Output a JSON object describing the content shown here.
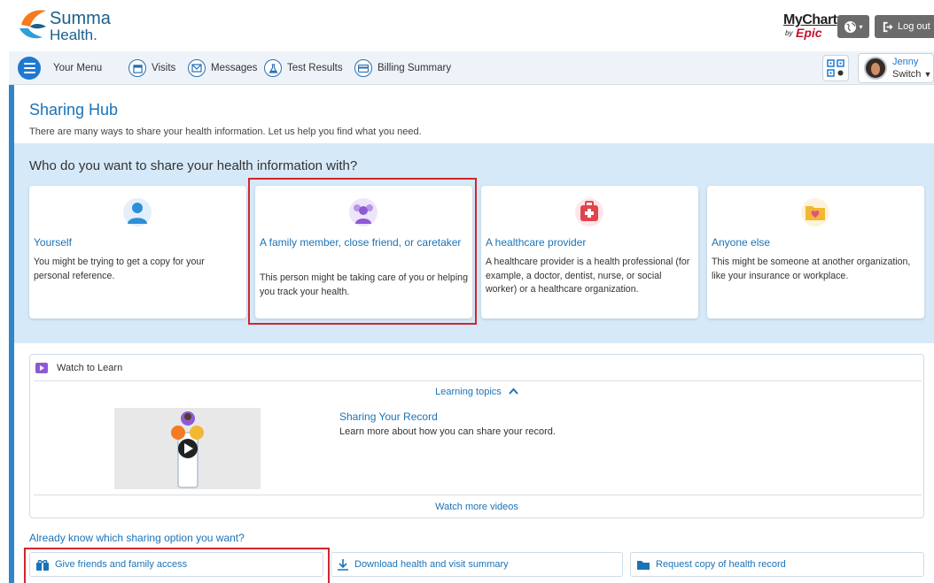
{
  "brand": {
    "name_line1": "Summa",
    "name_line2": "Health."
  },
  "mychart": {
    "text": "MyChart",
    "by": "by",
    "epic": "Epic"
  },
  "header": {
    "logout_label": "Log out"
  },
  "nav": {
    "menu_label": "Your Menu",
    "items": [
      {
        "label": "Visits",
        "icon": "calendar-icon"
      },
      {
        "label": "Messages",
        "icon": "envelope-icon"
      },
      {
        "label": "Test Results",
        "icon": "flask-icon"
      },
      {
        "label": "Billing Summary",
        "icon": "card-icon"
      }
    ]
  },
  "user": {
    "name": "Jenny",
    "switch_label": "Switch"
  },
  "page": {
    "title": "Sharing Hub",
    "subtitle": "There are many ways to share your health information. Let us help you find what you need."
  },
  "share": {
    "question": "Who do you want to share your health information with?",
    "cards": [
      {
        "title": "Yourself",
        "desc": "You might be trying to get a copy for your personal reference.",
        "icon": "person-icon",
        "color": "#2e8fd6"
      },
      {
        "title": "A family member, close friend, or caretaker",
        "desc": "This person might be taking care of you or helping you track your health.",
        "icon": "group-icon",
        "color": "#8d5ad6"
      },
      {
        "title": "A healthcare provider",
        "desc": "A healthcare provider is a health professional (for example, a doctor, dentist, nurse, or social worker) or a healthcare organization.",
        "icon": "medical-bag-icon",
        "color": "#e0454f"
      },
      {
        "title": "Anyone else",
        "desc": "This might be someone at another organization, like your insurance or workplace.",
        "icon": "folder-heart-icon",
        "color": "#f2b833"
      }
    ]
  },
  "watch": {
    "header": "Watch to Learn",
    "topics_label": "Learning topics",
    "video_title": "Sharing Your Record",
    "video_desc": "Learn more about how you can share your record.",
    "more_label": "Watch more videos"
  },
  "options": {
    "heading": "Already know which sharing option you want?",
    "items": [
      {
        "label": "Give friends and family access",
        "icon": "gift-icon"
      },
      {
        "label": "Download health and visit summary",
        "icon": "download-icon"
      },
      {
        "label": "Request copy of health record",
        "icon": "folder-icon"
      }
    ]
  },
  "colors": {
    "accent": "#1a73b8",
    "nav_bg": "#eef3f9",
    "share_bg": "#d6e9f8",
    "highlight": "#d1262d"
  }
}
